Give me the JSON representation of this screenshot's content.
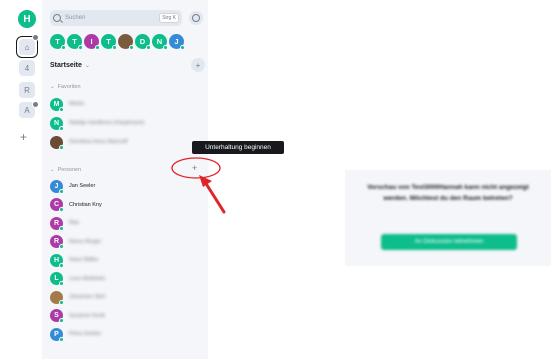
{
  "colors": {
    "accent": "#0dbd8b",
    "panel_bg": "#f4f6f9",
    "tooltip_bg": "#17191c",
    "annotation_red": "#e0242a"
  },
  "rail": {
    "home_initial": "H",
    "space_initial": "4",
    "space2_initial": "R",
    "space3_initial": "A",
    "add_label": "+"
  },
  "search": {
    "placeholder": "Suchen",
    "shortcut": "Strg K"
  },
  "recents": [
    {
      "initial": "T",
      "color": "#0dbd8b"
    },
    {
      "initial": "T",
      "color": "#0dbd8b"
    },
    {
      "initial": "I",
      "color": "#ac3ba8"
    },
    {
      "initial": "T",
      "color": "#0dbd8b"
    },
    {
      "initial": "",
      "color": "#7a5c3c"
    },
    {
      "initial": "D",
      "color": "#0dbd8b"
    },
    {
      "initial": "N",
      "color": "#0dbd8b"
    },
    {
      "initial": "J",
      "color": "#368bd6"
    }
  ],
  "home": {
    "title": "Startseite",
    "chevron": "⌄",
    "add": "+"
  },
  "favorites": {
    "header": "Favoriten",
    "rooms": [
      {
        "initial": "M",
        "color": "#0dbd8b",
        "name": "Marko"
      },
      {
        "initial": "N",
        "color": "#0dbd8b",
        "name": "Natalja Sandkova (Hauptraum)"
      },
      {
        "initial": "",
        "color": "#6b4a36",
        "name": "Dorothea Hunz Mannoff"
      }
    ]
  },
  "people": {
    "header": "Personen",
    "add": "+",
    "rooms": [
      {
        "initial": "J",
        "color": "#368bd6",
        "name": "Jan Seeler",
        "blurred": false
      },
      {
        "initial": "C",
        "color": "#ac3ba8",
        "name": "Christian Kny",
        "blurred": false
      },
      {
        "initial": "R",
        "color": "#ac3ba8",
        "name": "Rita",
        "blurred": true
      },
      {
        "initial": "R",
        "color": "#ac3ba8",
        "name": "Remo Ringer",
        "blurred": true
      },
      {
        "initial": "H",
        "color": "#0dbd8b",
        "name": "Hans Wiltke",
        "blurred": true
      },
      {
        "initial": "L",
        "color": "#0dbd8b",
        "name": "Leon Mobhelm",
        "blurred": true
      },
      {
        "initial": "",
        "color": "#a57a4a",
        "name": "Johannes Sieh",
        "blurred": true
      },
      {
        "initial": "S",
        "color": "#ac3ba8",
        "name": "Susanne Knolt",
        "blurred": true
      },
      {
        "initial": "P",
        "color": "#368bd6",
        "name": "Petra Seeber",
        "blurred": true
      }
    ]
  },
  "tooltip": {
    "text": "Unterhaltung beginnen"
  },
  "preview": {
    "message": "Vorschau von Test3000Hannah kann nicht angezeigt werden. Möchtest du den Raum betreten?",
    "button": "An Diskussion teilnehmen"
  }
}
